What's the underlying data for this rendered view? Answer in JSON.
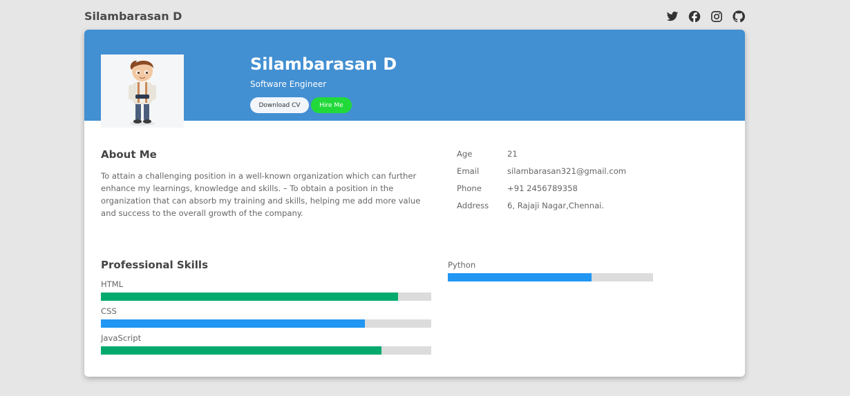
{
  "header": {
    "brand": "Silambarasan D",
    "social": [
      {
        "icon": "twitter-icon"
      },
      {
        "icon": "facebook-icon"
      },
      {
        "icon": "instagram-icon"
      },
      {
        "icon": "github-icon"
      }
    ]
  },
  "profile": {
    "name": "Silambarasan D",
    "role": "Software Engineer",
    "download_label": "Download CV",
    "hire_label": "Hire Me",
    "colors": {
      "banner": "#428fd2",
      "hire_button": "#22d93a"
    }
  },
  "about": {
    "title": "About Me",
    "text": "To attain a challenging position in a well-known organization which can further enhance my learnings, knowledge and skills. – To obtain a position in the organization that can absorb my training and skills, helping me add more value and success to the overall growth of the company."
  },
  "info": [
    {
      "label": "Age",
      "value": "21"
    },
    {
      "label": "Email",
      "value": "silambarasan321@gmail.com"
    },
    {
      "label": "Phone",
      "value": "+91 2456789358"
    },
    {
      "label": "Address",
      "value": "6, Rajaji Nagar,Chennai."
    }
  ],
  "skills": {
    "title": "Professional Skills",
    "items": [
      {
        "name": "HTML",
        "level": 0.9,
        "color": "#04aa6d"
      },
      {
        "name": "CSS",
        "level": 0.8,
        "color": "#2196f3"
      },
      {
        "name": "JavaScript",
        "level": 0.85,
        "color": "#04aa6d"
      },
      {
        "name": "Python",
        "level": 0.7,
        "color": "#2196f3"
      }
    ]
  }
}
